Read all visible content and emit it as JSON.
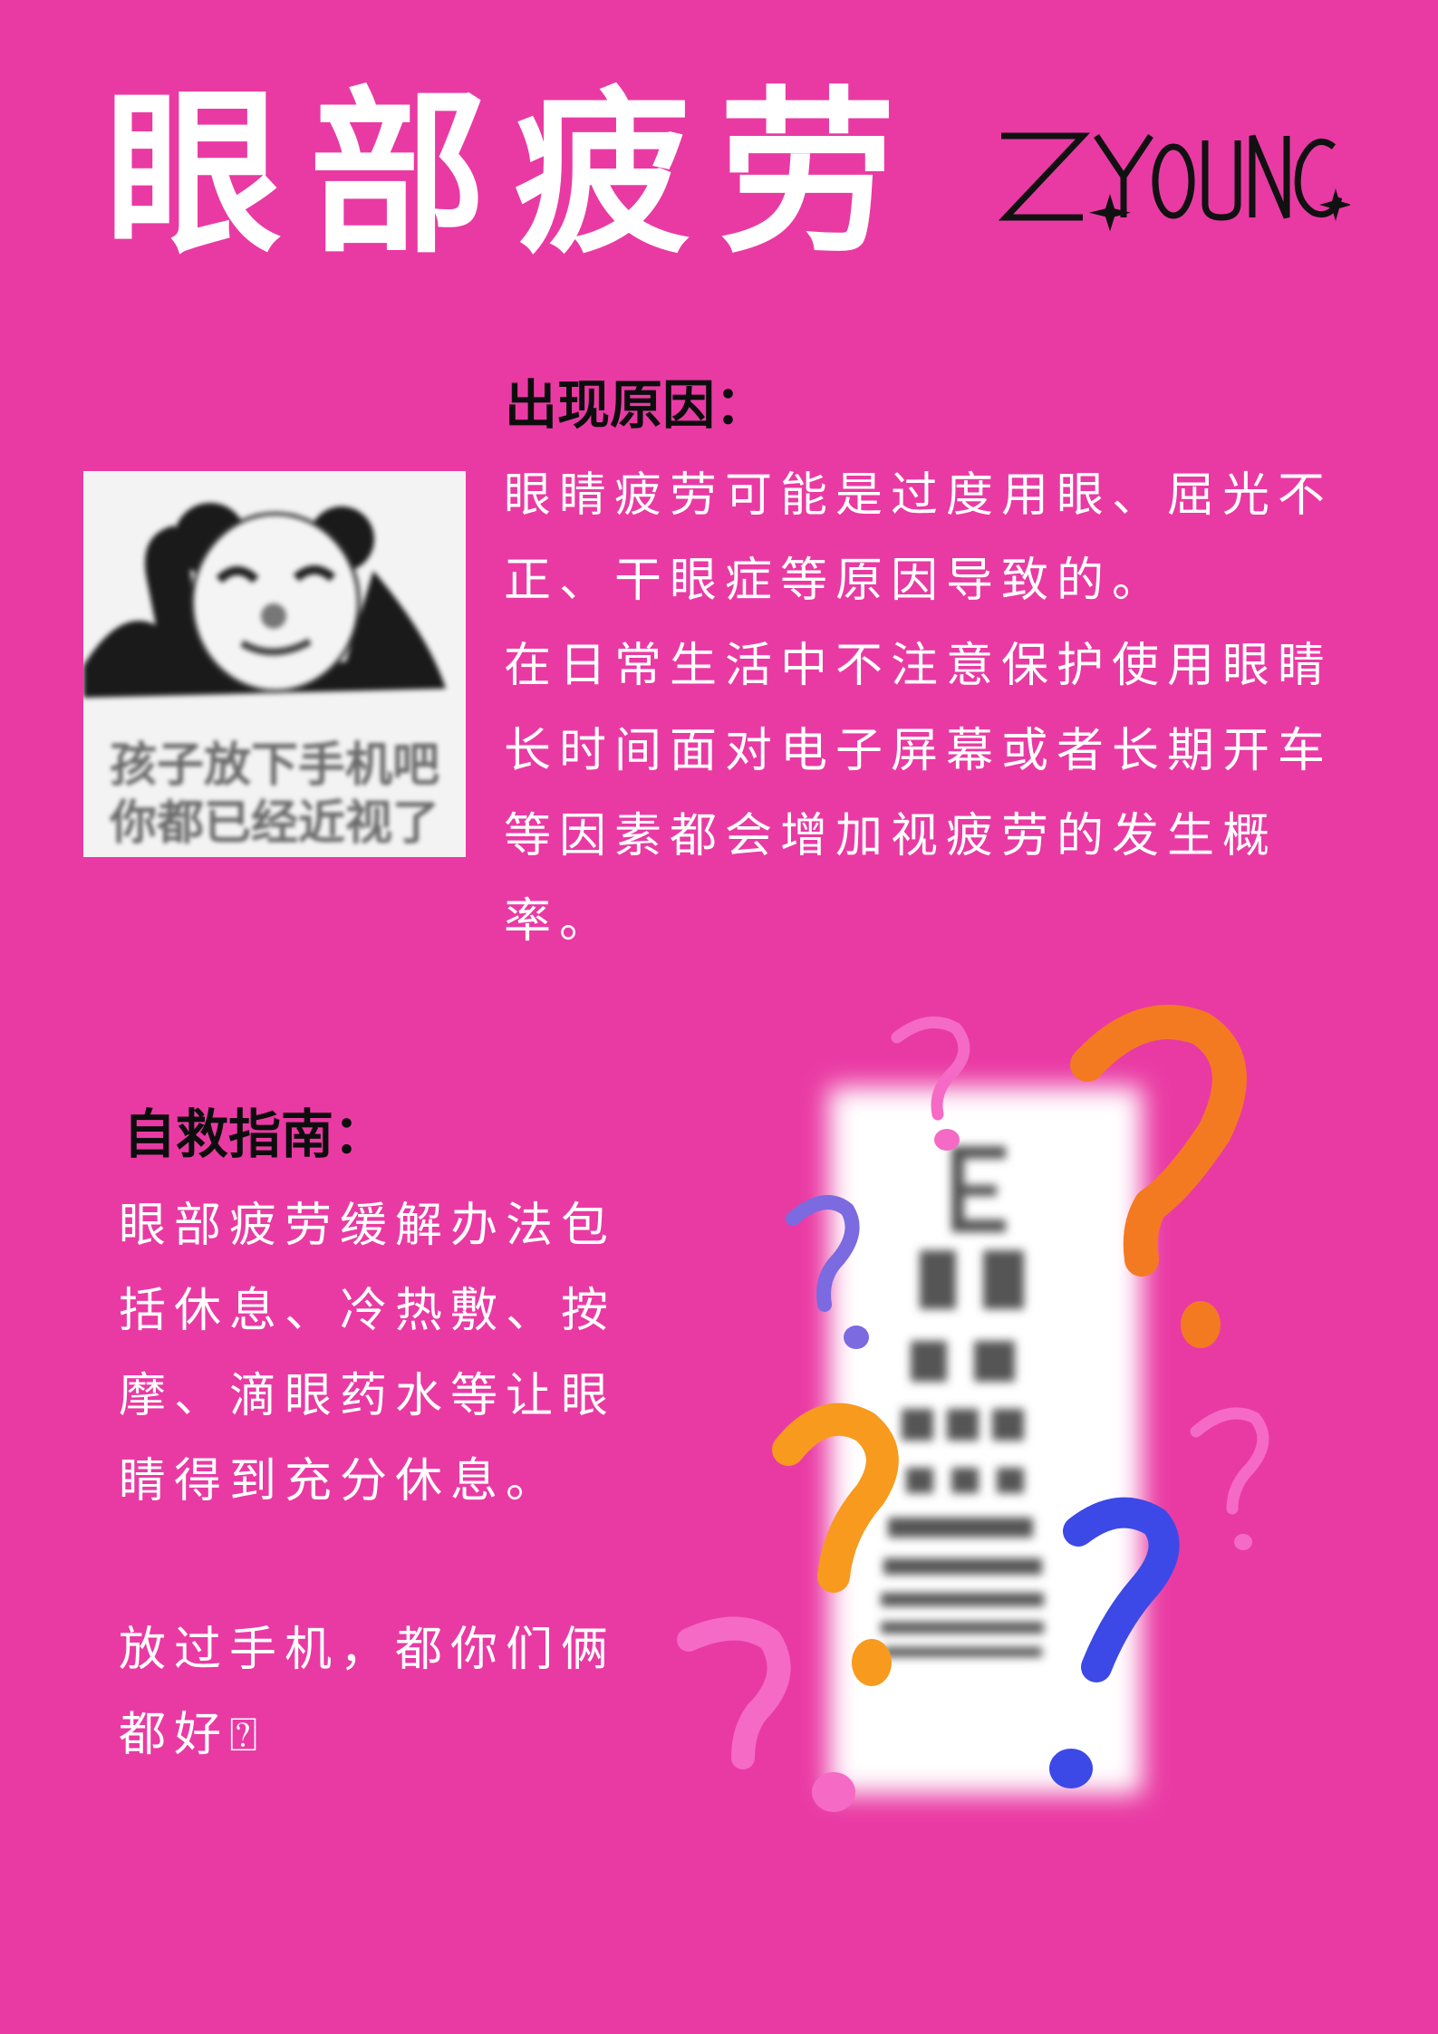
{
  "header": {
    "title": "眼部疲劳",
    "logo_text": "ZYOUNG"
  },
  "meme": {
    "caption_line1": "孩子放下手机吧",
    "caption_line2": "你都已经近视了"
  },
  "cause": {
    "heading": "出现原因：",
    "lines": [
      "眼睛疲劳可能是过度用眼、屈光不",
      "正、干眼症等原因导致的。",
      "在日常生活中不注意保护使用眼睛",
      "长时间面对电子屏幕或者长期开车",
      "等因素都会增加视疲劳的发生概",
      "率。"
    ]
  },
  "guide": {
    "heading": "自救指南：",
    "lines": [
      "眼部疲劳缓解办法包",
      "括休息、冷热敷、按",
      "摩、滴眼药水等让眼",
      "睛得到充分休息。"
    ],
    "closing_lines": [
      "放过手机，都你们俩",
      "都好⍰"
    ]
  },
  "colors": {
    "background": "#e93aa3",
    "text_light": "#ffffff",
    "text_dark": "#0d0d0d",
    "q_orange": "#f47a22",
    "q_amber": "#f79a1e",
    "q_blue": "#3c49e6",
    "q_lavender": "#7b6ae0",
    "q_pink": "#f56ac5"
  }
}
